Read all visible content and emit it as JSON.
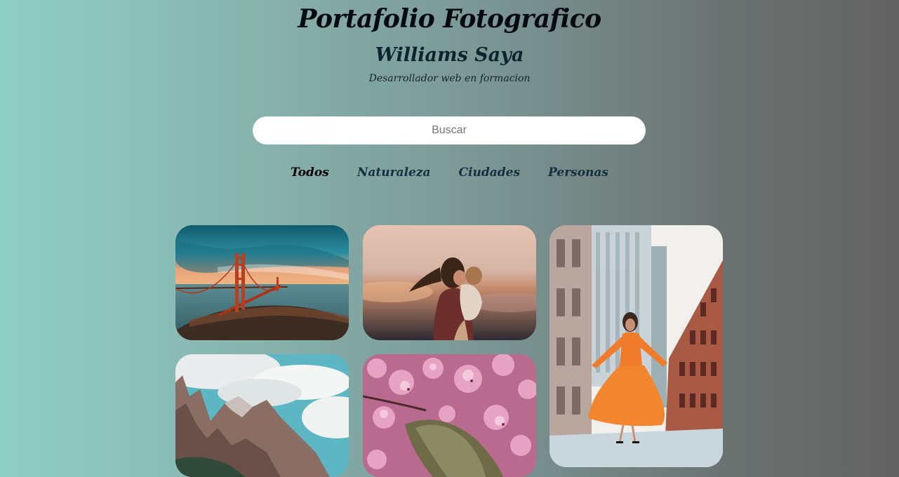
{
  "header": {
    "title": "Portafolio Fotografico",
    "author": "Williams Saya",
    "tagline": "Desarrollador web en formacion"
  },
  "search": {
    "placeholder": "Buscar",
    "value": ""
  },
  "nav": {
    "items": [
      {
        "label": "Todos",
        "active": true
      },
      {
        "label": "Naturaleza",
        "active": false
      },
      {
        "label": "Ciudades",
        "active": false
      },
      {
        "label": "Personas",
        "active": false
      }
    ]
  },
  "gallery": {
    "photos": [
      {
        "subject": "golden-gate-bridge",
        "category": "Ciudades"
      },
      {
        "subject": "mother-and-child",
        "category": "Personas"
      },
      {
        "subject": "woman-in-orange-dress-street",
        "category": "Personas"
      },
      {
        "subject": "mountains-and-clouds",
        "category": "Naturaleza"
      },
      {
        "subject": "cherry-blossoms",
        "category": "Naturaleza"
      }
    ]
  },
  "colors": {
    "background_left": "#8fcfc6",
    "background_right": "#636262",
    "title": "#050a0f",
    "nav_text": "#143040"
  }
}
